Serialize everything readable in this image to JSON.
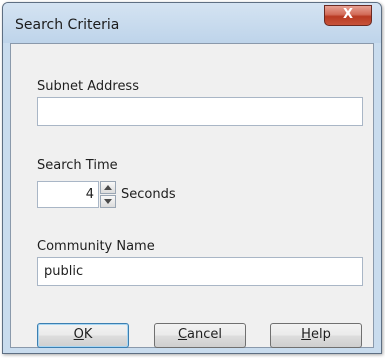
{
  "window": {
    "title": "Search Criteria",
    "close_label": "X"
  },
  "subnet": {
    "label": "Subnet Address",
    "value": ""
  },
  "search_time": {
    "label": "Search Time",
    "value": "4",
    "unit": "Seconds"
  },
  "community": {
    "label": "Community Name",
    "value": "public"
  },
  "buttons": {
    "ok": {
      "mnemonic": "O",
      "rest": "K"
    },
    "cancel": {
      "mnemonic": "C",
      "rest": "ancel"
    },
    "help": {
      "mnemonic": "H",
      "rest": "elp"
    }
  },
  "icons": {
    "close": "close-icon",
    "spin_up": "chevron-up-icon",
    "spin_down": "chevron-down-icon"
  }
}
